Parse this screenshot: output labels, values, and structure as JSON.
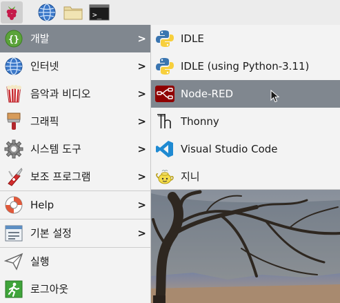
{
  "taskbar": {
    "buttons": [
      {
        "icon": "raspberry-pi-menu-icon"
      },
      {
        "icon": "web-browser-globe-icon"
      },
      {
        "icon": "file-manager-folder-icon"
      },
      {
        "icon": "terminal-icon",
        "glyph": ">_"
      }
    ]
  },
  "main_menu": {
    "items": [
      {
        "label": "개발",
        "icon": "programming-braces-icon",
        "submenu": true,
        "selected": true
      },
      {
        "label": "인터넷",
        "icon": "globe-icon",
        "submenu": true
      },
      {
        "label": "음악과 비디오",
        "icon": "film-popcorn-icon",
        "submenu": true
      },
      {
        "label": "그래픽",
        "icon": "paintbrush-icon",
        "submenu": true
      },
      {
        "label": "시스템 도구",
        "icon": "gear-icon",
        "submenu": true
      },
      {
        "label": "보조 프로그램",
        "icon": "pocket-knife-icon",
        "submenu": true
      },
      {
        "label": "Help",
        "icon": "lifebuoy-icon",
        "submenu": true
      },
      {
        "label": "기본 설정",
        "icon": "preferences-panel-icon",
        "submenu": true
      },
      {
        "label": "실행",
        "icon": "paper-plane-icon",
        "submenu": false
      },
      {
        "label": "로그아웃",
        "icon": "exit-running-man-icon",
        "submenu": false
      }
    ],
    "arrow_glyph": "›",
    "arrow_char": ">"
  },
  "submenu": {
    "items": [
      {
        "label": "IDLE",
        "icon": "python-icon"
      },
      {
        "label": "IDLE (using Python-3.11)",
        "icon": "python-icon"
      },
      {
        "label": "Node-RED",
        "icon": "node-red-icon",
        "selected": true
      },
      {
        "label": "Thonny",
        "icon": "thonny-icon"
      },
      {
        "label": "Visual Studio Code",
        "icon": "vscode-icon"
      },
      {
        "label": "지니",
        "icon": "geany-teapot-icon"
      }
    ]
  },
  "colors": {
    "menu_bg": "#f3f3f3",
    "selected_bg": "#80878f",
    "taskbar_bg": "#ececec",
    "python_blue": "#3a75b0",
    "python_yellow": "#f7cf3c",
    "node_red": "#8f0000",
    "vscode_blue": "#1f8ad2",
    "exit_green": "#3fa43a"
  }
}
